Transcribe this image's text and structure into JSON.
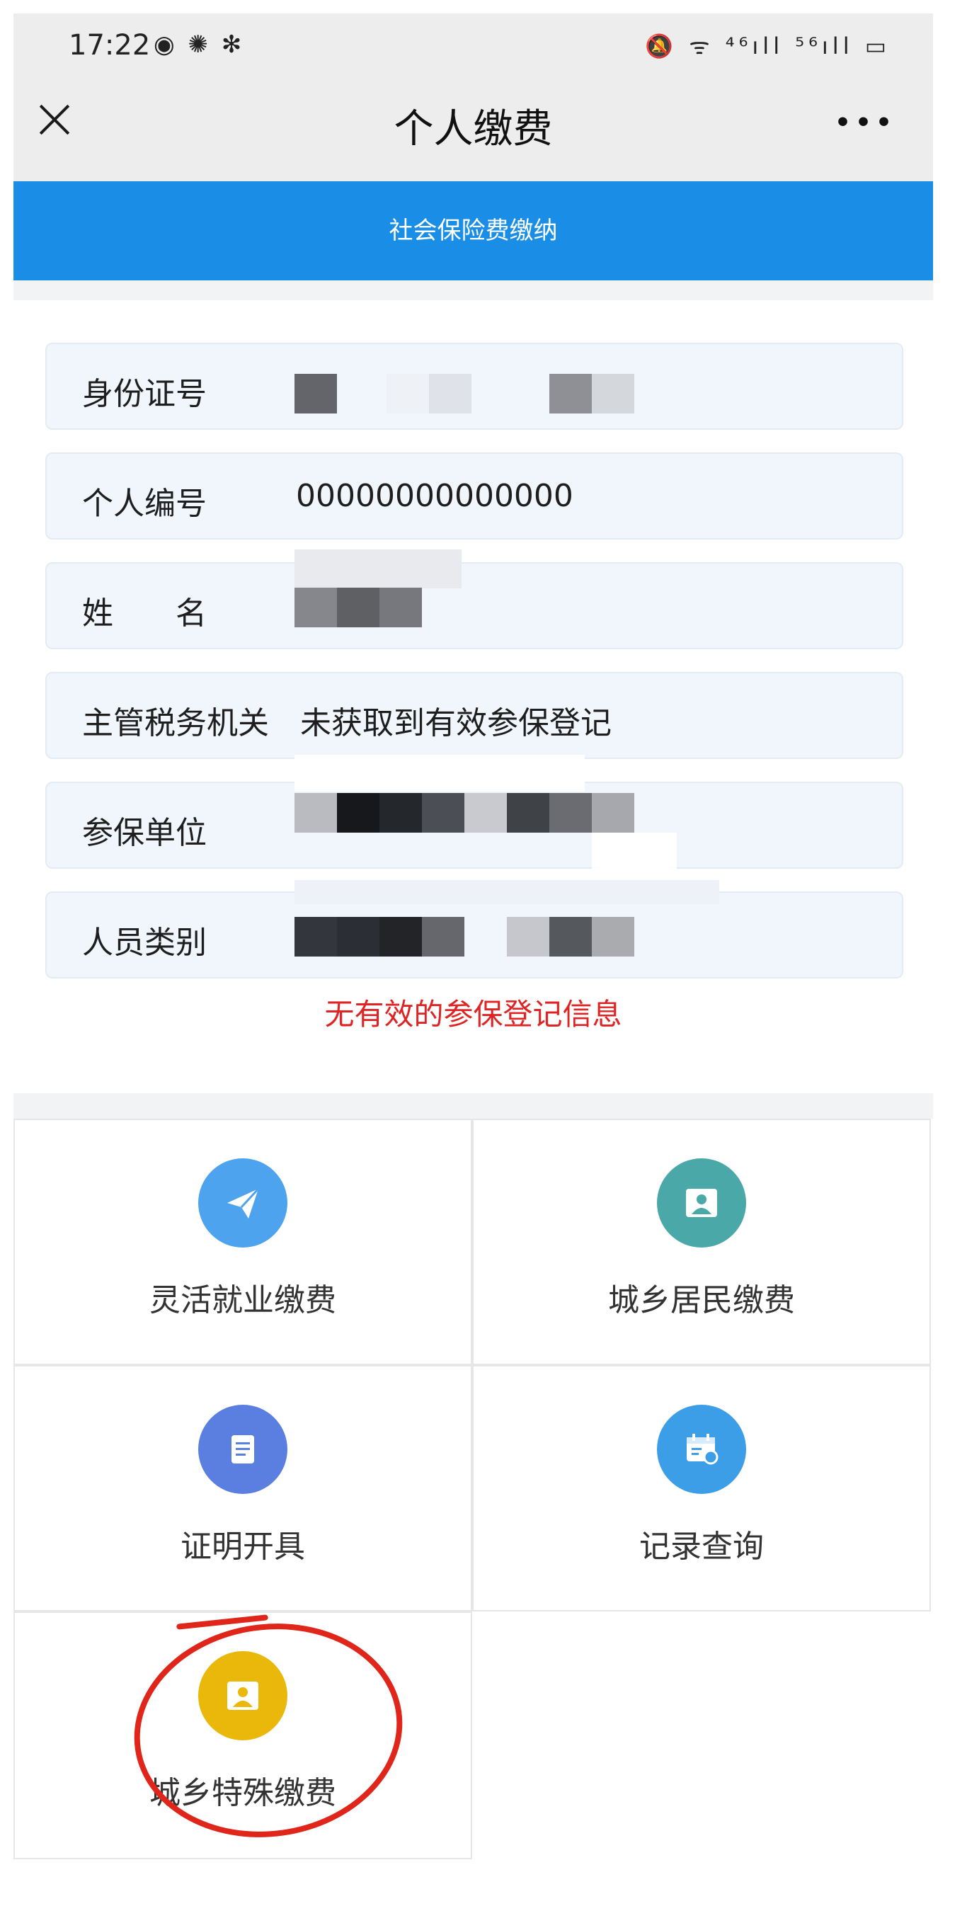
{
  "status_bar": {
    "time": "17:22",
    "left_icons": "◉ ✺ ✻",
    "right_icons": "🔕 ᯤ ⁴⁶ıll ⁵⁶ıll ▭"
  },
  "header": {
    "title": "个人缴费",
    "more": "•••"
  },
  "banner": {
    "text": "社会保险费缴纳"
  },
  "form": {
    "rows": [
      {
        "label": "身份证号",
        "value": ""
      },
      {
        "label": "个人编号",
        "value": "00000000000000"
      },
      {
        "label": "姓　　名",
        "value": ""
      },
      {
        "label": "主管税务机关",
        "value": "未获取到有效参保登记"
      },
      {
        "label": "参保单位",
        "value": ""
      },
      {
        "label": "人员类别",
        "value": ""
      }
    ],
    "warning": "无有效的参保登记信息"
  },
  "grid": {
    "items": [
      {
        "label": "灵活就业缴费",
        "icon": "paper-plane-icon",
        "color": "#4da3ee"
      },
      {
        "label": "城乡居民缴费",
        "icon": "person-icon",
        "color": "#4aa8a8"
      },
      {
        "label": "证明开具",
        "icon": "document-icon",
        "color": "#5b7fe0"
      },
      {
        "label": "记录查询",
        "icon": "calendar-icon",
        "color": "#3d9ee8"
      },
      {
        "label": "城乡特殊缴费",
        "icon": "person-icon",
        "color": "#e9b80b"
      }
    ]
  },
  "colors": {
    "banner": "#1a8ee6",
    "warning": "#e02424",
    "annotation": "#e0251a"
  }
}
